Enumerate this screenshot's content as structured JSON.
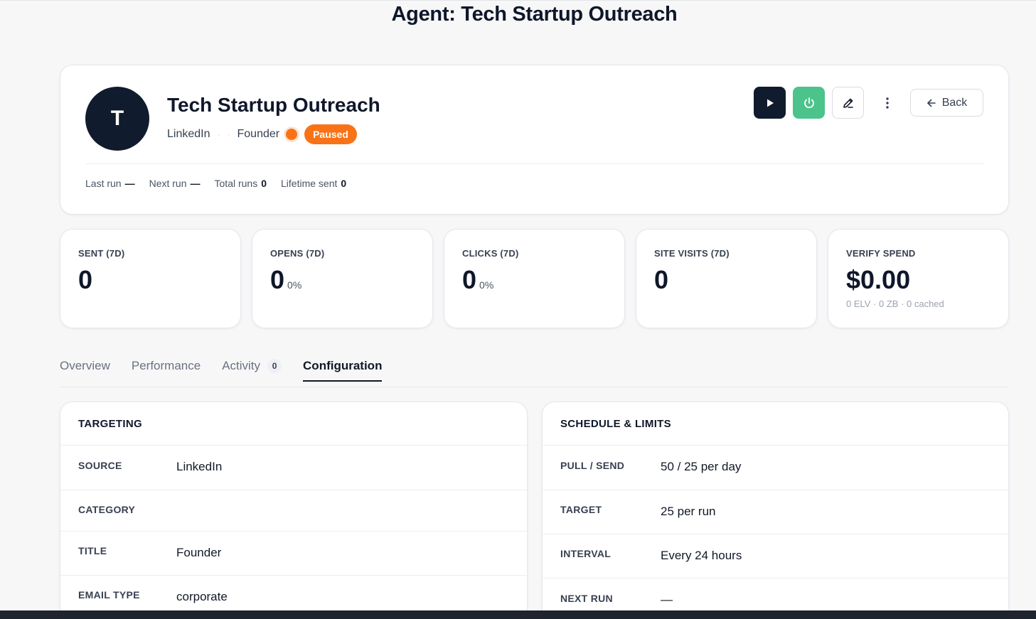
{
  "page": {
    "title": "Agent: Tech Startup Outreach"
  },
  "agent": {
    "initial": "T",
    "name": "Tech Startup Outreach",
    "source": "LinkedIn",
    "title": "Founder",
    "status": "Paused",
    "status_color": "#f97316"
  },
  "header_stats": {
    "last_run_label": "Last run",
    "last_run_value": "—",
    "next_run_label": "Next run",
    "next_run_value": "—",
    "total_runs_label": "Total runs",
    "total_runs_value": "0",
    "lifetime_sent_label": "Lifetime sent",
    "lifetime_sent_value": "0"
  },
  "actions": {
    "back_label": "Back"
  },
  "metrics": [
    {
      "label": "SENT (7D)",
      "value": "0",
      "pct": ""
    },
    {
      "label": "OPENS (7D)",
      "value": "0",
      "pct": "0%"
    },
    {
      "label": "CLICKS (7D)",
      "value": "0",
      "pct": "0%"
    },
    {
      "label": "SITE VISITS (7D)",
      "value": "0",
      "pct": ""
    },
    {
      "label": "VERIFY SPEND",
      "value": "$0.00",
      "pct": "",
      "sub": "0 ELV · 0 ZB · 0 cached"
    }
  ],
  "tabs": [
    {
      "label": "Overview"
    },
    {
      "label": "Performance"
    },
    {
      "label": "Activity",
      "count": "0"
    },
    {
      "label": "Configuration",
      "active": true
    }
  ],
  "targeting": {
    "title": "TARGETING",
    "rows": [
      {
        "key": "SOURCE",
        "value": "LinkedIn"
      },
      {
        "key": "CATEGORY",
        "value": ""
      },
      {
        "key": "TITLE",
        "value": "Founder"
      },
      {
        "key": "EMAIL TYPE",
        "value": "corporate"
      }
    ]
  },
  "schedule": {
    "title": "SCHEDULE & LIMITS",
    "rows": [
      {
        "key": "PULL / SEND",
        "value": "50 / 25 per day"
      },
      {
        "key": "TARGET",
        "value": "25 per run"
      },
      {
        "key": "INTERVAL",
        "value": "Every 24 hours"
      },
      {
        "key": "NEXT RUN",
        "value": "—"
      }
    ]
  },
  "colors": {
    "accent_dark": "#111b2e",
    "power_green": "#4cc38a",
    "paused_orange": "#f97316"
  },
  "icons": [
    "play-icon",
    "power-icon",
    "pencil-icon",
    "more-vertical-icon",
    "arrow-left-icon"
  ]
}
